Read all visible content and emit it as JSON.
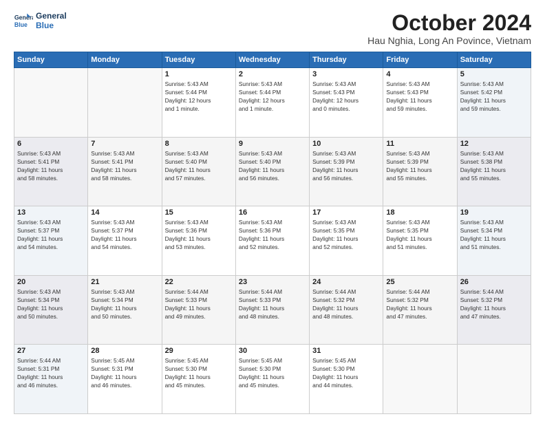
{
  "header": {
    "logo_line1": "General",
    "logo_line2": "Blue",
    "month": "October 2024",
    "location": "Hau Nghia, Long An Povince, Vietnam"
  },
  "weekdays": [
    "Sunday",
    "Monday",
    "Tuesday",
    "Wednesday",
    "Thursday",
    "Friday",
    "Saturday"
  ],
  "weeks": [
    [
      {
        "day": "",
        "info": ""
      },
      {
        "day": "",
        "info": ""
      },
      {
        "day": "1",
        "info": "Sunrise: 5:43 AM\nSunset: 5:44 PM\nDaylight: 12 hours\nand 1 minute."
      },
      {
        "day": "2",
        "info": "Sunrise: 5:43 AM\nSunset: 5:44 PM\nDaylight: 12 hours\nand 1 minute."
      },
      {
        "day": "3",
        "info": "Sunrise: 5:43 AM\nSunset: 5:43 PM\nDaylight: 12 hours\nand 0 minutes."
      },
      {
        "day": "4",
        "info": "Sunrise: 5:43 AM\nSunset: 5:43 PM\nDaylight: 11 hours\nand 59 minutes."
      },
      {
        "day": "5",
        "info": "Sunrise: 5:43 AM\nSunset: 5:42 PM\nDaylight: 11 hours\nand 59 minutes."
      }
    ],
    [
      {
        "day": "6",
        "info": "Sunrise: 5:43 AM\nSunset: 5:41 PM\nDaylight: 11 hours\nand 58 minutes."
      },
      {
        "day": "7",
        "info": "Sunrise: 5:43 AM\nSunset: 5:41 PM\nDaylight: 11 hours\nand 58 minutes."
      },
      {
        "day": "8",
        "info": "Sunrise: 5:43 AM\nSunset: 5:40 PM\nDaylight: 11 hours\nand 57 minutes."
      },
      {
        "day": "9",
        "info": "Sunrise: 5:43 AM\nSunset: 5:40 PM\nDaylight: 11 hours\nand 56 minutes."
      },
      {
        "day": "10",
        "info": "Sunrise: 5:43 AM\nSunset: 5:39 PM\nDaylight: 11 hours\nand 56 minutes."
      },
      {
        "day": "11",
        "info": "Sunrise: 5:43 AM\nSunset: 5:39 PM\nDaylight: 11 hours\nand 55 minutes."
      },
      {
        "day": "12",
        "info": "Sunrise: 5:43 AM\nSunset: 5:38 PM\nDaylight: 11 hours\nand 55 minutes."
      }
    ],
    [
      {
        "day": "13",
        "info": "Sunrise: 5:43 AM\nSunset: 5:37 PM\nDaylight: 11 hours\nand 54 minutes."
      },
      {
        "day": "14",
        "info": "Sunrise: 5:43 AM\nSunset: 5:37 PM\nDaylight: 11 hours\nand 54 minutes."
      },
      {
        "day": "15",
        "info": "Sunrise: 5:43 AM\nSunset: 5:36 PM\nDaylight: 11 hours\nand 53 minutes."
      },
      {
        "day": "16",
        "info": "Sunrise: 5:43 AM\nSunset: 5:36 PM\nDaylight: 11 hours\nand 52 minutes."
      },
      {
        "day": "17",
        "info": "Sunrise: 5:43 AM\nSunset: 5:35 PM\nDaylight: 11 hours\nand 52 minutes."
      },
      {
        "day": "18",
        "info": "Sunrise: 5:43 AM\nSunset: 5:35 PM\nDaylight: 11 hours\nand 51 minutes."
      },
      {
        "day": "19",
        "info": "Sunrise: 5:43 AM\nSunset: 5:34 PM\nDaylight: 11 hours\nand 51 minutes."
      }
    ],
    [
      {
        "day": "20",
        "info": "Sunrise: 5:43 AM\nSunset: 5:34 PM\nDaylight: 11 hours\nand 50 minutes."
      },
      {
        "day": "21",
        "info": "Sunrise: 5:43 AM\nSunset: 5:34 PM\nDaylight: 11 hours\nand 50 minutes."
      },
      {
        "day": "22",
        "info": "Sunrise: 5:44 AM\nSunset: 5:33 PM\nDaylight: 11 hours\nand 49 minutes."
      },
      {
        "day": "23",
        "info": "Sunrise: 5:44 AM\nSunset: 5:33 PM\nDaylight: 11 hours\nand 48 minutes."
      },
      {
        "day": "24",
        "info": "Sunrise: 5:44 AM\nSunset: 5:32 PM\nDaylight: 11 hours\nand 48 minutes."
      },
      {
        "day": "25",
        "info": "Sunrise: 5:44 AM\nSunset: 5:32 PM\nDaylight: 11 hours\nand 47 minutes."
      },
      {
        "day": "26",
        "info": "Sunrise: 5:44 AM\nSunset: 5:32 PM\nDaylight: 11 hours\nand 47 minutes."
      }
    ],
    [
      {
        "day": "27",
        "info": "Sunrise: 5:44 AM\nSunset: 5:31 PM\nDaylight: 11 hours\nand 46 minutes."
      },
      {
        "day": "28",
        "info": "Sunrise: 5:45 AM\nSunset: 5:31 PM\nDaylight: 11 hours\nand 46 minutes."
      },
      {
        "day": "29",
        "info": "Sunrise: 5:45 AM\nSunset: 5:30 PM\nDaylight: 11 hours\nand 45 minutes."
      },
      {
        "day": "30",
        "info": "Sunrise: 5:45 AM\nSunset: 5:30 PM\nDaylight: 11 hours\nand 45 minutes."
      },
      {
        "day": "31",
        "info": "Sunrise: 5:45 AM\nSunset: 5:30 PM\nDaylight: 11 hours\nand 44 minutes."
      },
      {
        "day": "",
        "info": ""
      },
      {
        "day": "",
        "info": ""
      }
    ]
  ]
}
